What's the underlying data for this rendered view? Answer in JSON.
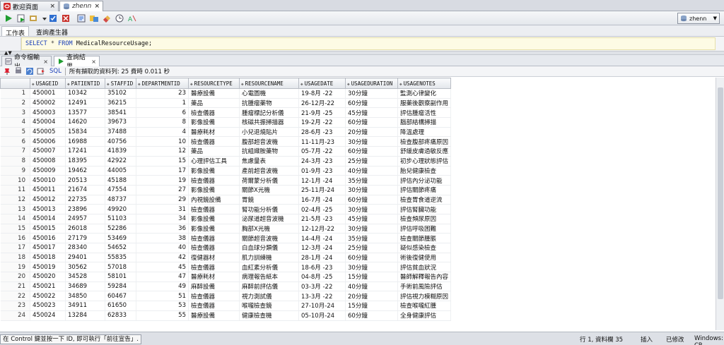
{
  "tabs": [
    {
      "label": "歡迎頁面",
      "close": "×"
    },
    {
      "label": "zhenn",
      "close": "×"
    }
  ],
  "toolbar": {
    "connection": "zhenn",
    "colors": {
      "run": "#1f9d2f",
      "commit": "#2f6fd0",
      "rollback": "#c9322c"
    }
  },
  "worksheet_tabs": {
    "active": "工作表",
    "other": "查詢產生器"
  },
  "editor": {
    "select_kw": "SELECT",
    "star": "*",
    "from_kw": "FROM",
    "table": "MedicalResourceUsage;"
  },
  "result_tabs": {
    "output": "命令檔輸出",
    "result": "查詢結果",
    "close": "×"
  },
  "result_bar": {
    "sql_label": "SQL",
    "message": "所有擷取的資料列: 25 費時 0.011 秒"
  },
  "grid": {
    "columns": [
      "USAGEID",
      "PATIENTID",
      "STAFFID",
      "DEPARTMENTID",
      "RESOURCETYPE",
      "RESOURCENAME",
      "USAGEDATE",
      "USAGEDURATION",
      "USAGENOTES"
    ],
    "rows": [
      [
        "1",
        "450001",
        "10342",
        "35102",
        "23",
        "醫療設備",
        "心電圖機",
        "19-8月 -22",
        "30分鐘",
        "監測心律變化"
      ],
      [
        "2",
        "450002",
        "12491",
        "36215",
        "1",
        "藥品",
        "抗腫瘤藥物",
        "26-12月-22",
        "60分鐘",
        "服藥後觀察副作用"
      ],
      [
        "3",
        "450003",
        "13577",
        "38541",
        "6",
        "檢查儀器",
        "腫瘤標記分析儀",
        "21-9月 -25",
        "45分鐘",
        "評估腫瘤活性"
      ],
      [
        "4",
        "450004",
        "14620",
        "39673",
        "8",
        "影像設備",
        "核磁共振掃描器",
        "19-2月 -22",
        "60分鐘",
        "腦部結構掃描"
      ],
      [
        "5",
        "450005",
        "15834",
        "37488",
        "4",
        "醫療耗材",
        "小兒退燒貼片",
        "28-6月 -23",
        "20分鐘",
        "降溫處理"
      ],
      [
        "6",
        "450006",
        "16988",
        "40756",
        "10",
        "檢查儀器",
        "腹部超音波機",
        "11-11月-23",
        "30分鐘",
        "檢查腹部疼痛原因"
      ],
      [
        "7",
        "450007",
        "17241",
        "41839",
        "12",
        "藥品",
        "抗組織胺藥物",
        "05-7月 -22",
        "60分鐘",
        "舒緩皮膚過敏反應"
      ],
      [
        "8",
        "450008",
        "18395",
        "42922",
        "15",
        "心理評估工具",
        "焦慮量表",
        "24-3月 -23",
        "25分鐘",
        "初步心理狀態評估"
      ],
      [
        "9",
        "450009",
        "19462",
        "44005",
        "17",
        "影像設備",
        "產前超音波機",
        "01-9月 -23",
        "40分鐘",
        "胎兒健康檢查"
      ],
      [
        "10",
        "450010",
        "20513",
        "45188",
        "19",
        "檢查儀器",
        "荷爾蒙分析儀",
        "12-1月 -24",
        "35分鐘",
        "評估內分泌功能"
      ],
      [
        "11",
        "450011",
        "21674",
        "47554",
        "27",
        "影像設備",
        "關節X光機",
        "25-11月-24",
        "30分鐘",
        "評估關節疼痛"
      ],
      [
        "12",
        "450012",
        "22735",
        "48737",
        "29",
        "內視鏡設備",
        "胃鏡",
        "16-7月 -24",
        "60分鐘",
        "檢查胃食道逆流"
      ],
      [
        "13",
        "450013",
        "23896",
        "49920",
        "31",
        "檢查儀器",
        "腎功能分析儀",
        "02-4月 -25",
        "30分鐘",
        "評估腎臟功能"
      ],
      [
        "14",
        "450014",
        "24957",
        "51103",
        "34",
        "影像設備",
        "泌尿道超音波機",
        "21-5月 -23",
        "45分鐘",
        "檢查頻尿原因"
      ],
      [
        "15",
        "450015",
        "26018",
        "52286",
        "36",
        "影像設備",
        "胸部X光機",
        "12-12月-22",
        "30分鐘",
        "評估呼吸困難"
      ],
      [
        "16",
        "450016",
        "27179",
        "53469",
        "38",
        "檢查儀器",
        "關節超音波機",
        "14-4月 -24",
        "35分鐘",
        "檢查關節腫脹"
      ],
      [
        "17",
        "450017",
        "28340",
        "54652",
        "40",
        "檢查儀器",
        "白血球分類儀",
        "12-3月 -24",
        "25分鐘",
        "疑似感染檢查"
      ],
      [
        "18",
        "450018",
        "29401",
        "55835",
        "42",
        "復健器材",
        "肌力訓練機",
        "28-1月 -24",
        "60分鐘",
        "術後復健使用"
      ],
      [
        "19",
        "450019",
        "30562",
        "57018",
        "45",
        "檢查儀器",
        "血紅素分析儀",
        "18-6月 -23",
        "30分鐘",
        "評估貧血狀況"
      ],
      [
        "20",
        "450020",
        "34528",
        "58101",
        "47",
        "醫療耗材",
        "病理報告紙本",
        "04-8月 -25",
        "15分鐘",
        "醫師解釋報告內容"
      ],
      [
        "21",
        "450021",
        "34689",
        "59284",
        "49",
        "麻醉設備",
        "麻醉前評估儀",
        "03-3月 -22",
        "40分鐘",
        "手術前風險評估"
      ],
      [
        "22",
        "450022",
        "34850",
        "60467",
        "51",
        "檢查儀器",
        "視力測試儀",
        "13-3月 -22",
        "20分鐘",
        "評估視力模糊原因"
      ],
      [
        "23",
        "450023",
        "34911",
        "61650",
        "53",
        "檢查儀器",
        "喉嚨檢查鏡",
        "27-10月-24",
        "15分鐘",
        "檢查喉嚨紅腫"
      ],
      [
        "24",
        "450024",
        "13284",
        "62833",
        "55",
        "醫療設備",
        "健康檢查機",
        "05-10月-24",
        "60分鐘",
        "全身健康評估"
      ]
    ]
  },
  "status": {
    "hint": "在 Control 鍵並按一下 ID, 即可執行「前往宣告」.",
    "position": "行 1, 資料欄 35",
    "insert": "插入",
    "modified": "已修改",
    "line_end": "Windows: CR"
  }
}
